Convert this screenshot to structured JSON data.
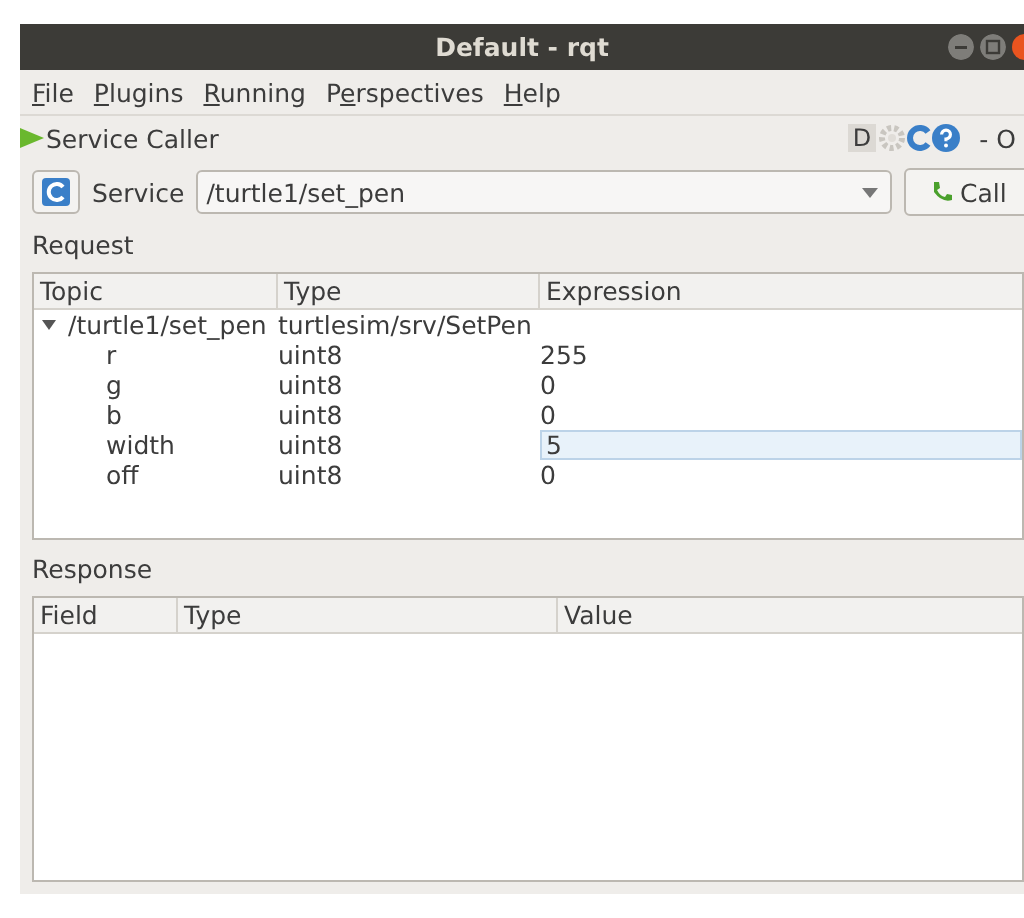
{
  "window": {
    "title": "Default - rqt"
  },
  "menu": [
    {
      "key": "F",
      "after": "ile"
    },
    {
      "key": "P",
      "after": "lugins"
    },
    {
      "key": "R",
      "after": "unning"
    },
    {
      "before": "P",
      "key": "e",
      "after": "rspectives"
    },
    {
      "key": "H",
      "after": "elp"
    }
  ],
  "plugin": {
    "title": "Service Caller",
    "d_button": "D",
    "close_text": "- O"
  },
  "service_bar": {
    "label": "Service",
    "value": "/turtle1/set_pen",
    "call_button": "Call"
  },
  "request": {
    "label": "Request",
    "columns": [
      "Topic",
      "Type",
      "Expression"
    ],
    "rows": [
      {
        "topic": "/turtle1/set_pen",
        "type": "turtlesim/srv/SetPen",
        "expression": "",
        "expanded": true,
        "children": [
          {
            "topic": "r",
            "type": "uint8",
            "expression": "255",
            "editing": false
          },
          {
            "topic": "g",
            "type": "uint8",
            "expression": "0",
            "editing": false
          },
          {
            "topic": "b",
            "type": "uint8",
            "expression": "0",
            "editing": false
          },
          {
            "topic": "width",
            "type": "uint8",
            "expression": "5",
            "editing": true
          },
          {
            "topic": "off",
            "type": "uint8",
            "expression": "0",
            "editing": false
          }
        ]
      }
    ]
  },
  "response": {
    "label": "Response",
    "columns": [
      "Field",
      "Type",
      "Value"
    ]
  }
}
